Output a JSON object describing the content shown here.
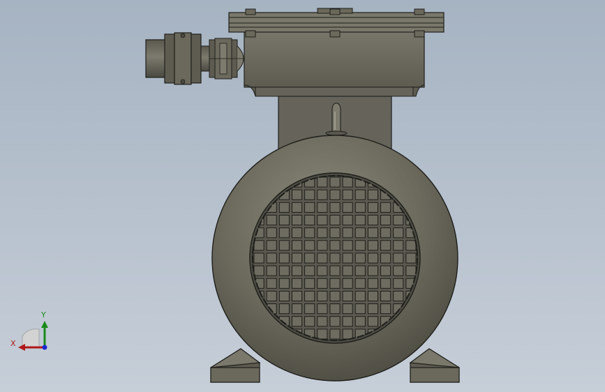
{
  "viewport": {
    "background_top": "#a6b3c2",
    "background_bottom": "#c6ced8"
  },
  "model": {
    "body_color": "#6b695c",
    "body_shadow": "#4f4d43",
    "body_highlight": "#8b897b",
    "edge_color": "#1e1e1a",
    "grille": {
      "rows": 13,
      "cols": 13
    }
  },
  "triad": {
    "x_label": "X",
    "y_label": "Y",
    "x_color": "#b01818",
    "y_color": "#1a8a1a",
    "z_color": "#1a2ad0"
  }
}
